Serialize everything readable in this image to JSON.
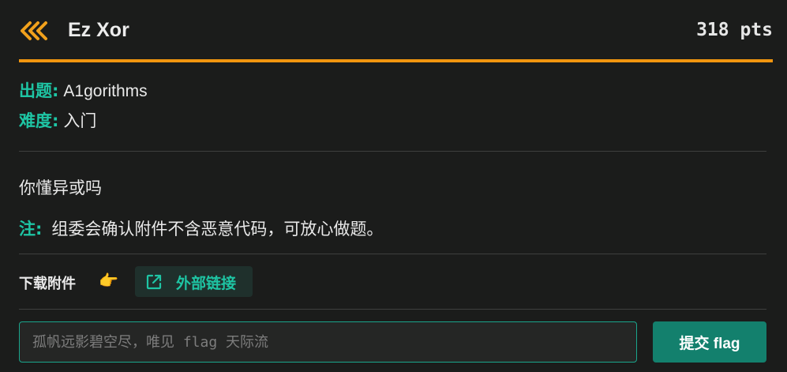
{
  "header": {
    "title": "Ez Xor",
    "points": "318 pts"
  },
  "meta": {
    "author_label": "出题:",
    "author": "A1gorithms",
    "difficulty_label": "难度:",
    "difficulty": "入门"
  },
  "description": "你懂异或吗",
  "note": {
    "label": "注:",
    "text": "组委会确认附件不含恶意代码，可放心做题。"
  },
  "attachments": {
    "label": "下载附件",
    "pointer_icon": "👉",
    "external_link_label": "外部链接"
  },
  "flag_form": {
    "placeholder": "孤帆远影碧空尽，唯见 flag 天际流",
    "value": "",
    "submit_label": "提交 flag"
  },
  "colors": {
    "accent": "#1ec5a4",
    "orange": "#f1950f",
    "submit": "#13806d"
  }
}
